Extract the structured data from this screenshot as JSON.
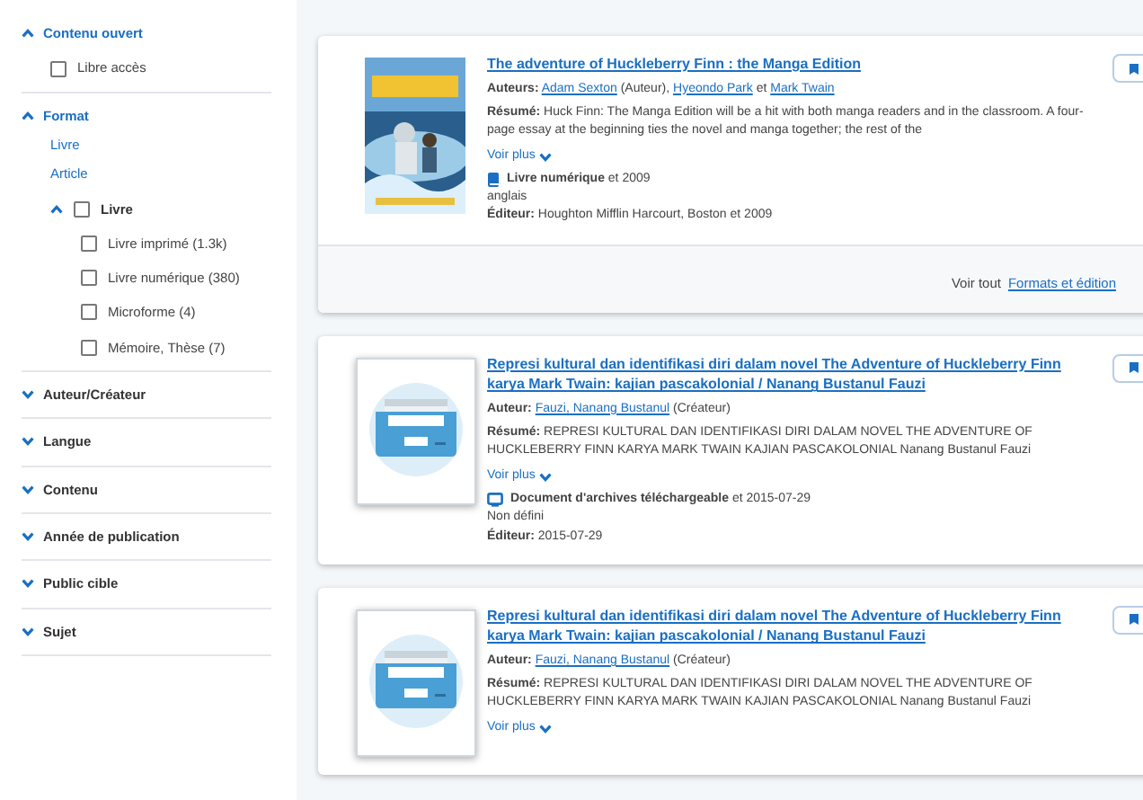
{
  "facets": [
    {
      "title": "Contenu ouvert",
      "expanded": true,
      "options": [
        {
          "label": "Libre accès",
          "checked": false
        }
      ]
    },
    {
      "title": "Format",
      "expanded": true,
      "links": [
        "Livre",
        "Article"
      ],
      "tree": [
        {
          "label": "Livre",
          "expanded": true,
          "checked": false,
          "children": [
            {
              "label": "Livre imprimé (1.3k)",
              "checked": false
            },
            {
              "label": "Livre numérique (380)",
              "checked": false
            },
            {
              "label": "Microforme (4)",
              "checked": false
            },
            {
              "label": "Mémoire, Thèse (7)",
              "checked": false
            }
          ]
        }
      ]
    },
    {
      "title": "Auteur/Créateur",
      "expanded": false
    },
    {
      "title": "Langue",
      "expanded": false
    },
    {
      "title": "Contenu",
      "expanded": false
    },
    {
      "title": "Année de publication",
      "expanded": false
    },
    {
      "title": "Public cible",
      "expanded": false
    },
    {
      "title": "Sujet",
      "expanded": false
    }
  ],
  "results": [
    {
      "kind": "book",
      "title": "The adventure of Huckleberry Finn : the Manga Edition",
      "authors_label": "Auteurs:",
      "authors": [
        {
          "text": "Adam Sexton",
          "link": true
        },
        {
          "text": "(Auteur),",
          "link": false
        },
        {
          "text": "Hyeondo Park",
          "link": true
        },
        {
          "text": "et",
          "link": false
        },
        {
          "text": "Mark Twain",
          "link": true
        }
      ],
      "summary_label": "Résumé:",
      "summary": "Huck Finn: The Manga Edition will be a hit with both manga readers and in the classroom. A four-page essay at the beginning ties the novel and manga together; the rest of the",
      "more": "Voir plus",
      "format": "Livre numérique",
      "format_date": "et 2009",
      "language": "anglais",
      "publisher_label": "Éditeur:",
      "publisher": "Houghton Mifflin Harcourt, Boston et 2009",
      "footer": {
        "label": "Voir tout",
        "link": "Formats et édition"
      }
    },
    {
      "kind": "archive",
      "title": "Represi kultural dan identifikasi diri dalam novel The Adventure of Huckleberry Finn karya Mark Twain: kajian pascakolonial / Nanang Bustanul Fauzi",
      "authors_label": "Auteur:",
      "authors": [
        {
          "text": "Fauzi, Nanang Bustanul",
          "link": true
        },
        {
          "text": "(Créateur)",
          "link": false
        }
      ],
      "summary_label": "Résumé:",
      "summary": "REPRESI KULTURAL DAN IDENTIFIKASI DIRI DALAM NOVEL THE ADVENTURE OF HUCKLEBERRY FINN KARYA MARK TWAIN KAJIAN PASCAKOLONIAL Nanang Bustanul Fauzi",
      "more": "Voir plus",
      "format": "Document d'archives téléchargeable",
      "format_date": "et 2015-07-29",
      "language": "Non défini",
      "publisher_label": "Éditeur:",
      "publisher": "2015-07-29"
    },
    {
      "kind": "archive",
      "title": "Represi kultural dan identifikasi diri dalam novel The Adventure of Huckleberry Finn karya Mark Twain: kajian pascakolonial / Nanang Bustanul Fauzi",
      "authors_label": "Auteur:",
      "authors": [
        {
          "text": "Fauzi, Nanang Bustanul",
          "link": true
        },
        {
          "text": "(Créateur)",
          "link": false
        }
      ],
      "summary_label": "Résumé:",
      "summary": "REPRESI KULTURAL DAN IDENTIFIKASI DIRI DALAM NOVEL THE ADVENTURE OF HUCKLEBERRY FINN KARYA MARK TWAIN KAJIAN PASCAKOLONIAL Nanang Bustanul Fauzi",
      "more": "Voir plus"
    }
  ]
}
